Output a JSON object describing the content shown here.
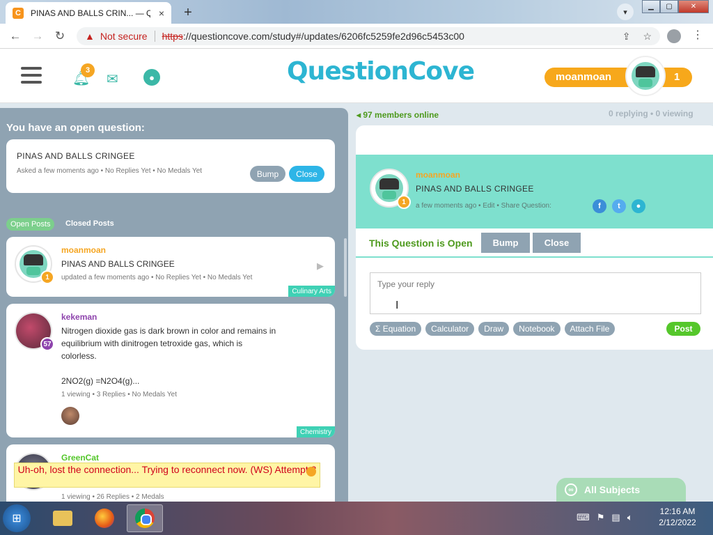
{
  "browser": {
    "tab_title": "PINAS AND BALLS CRIN... — Que",
    "tab_favicon": "C",
    "tab_close": "×",
    "new_tab": "+",
    "not_secure": "Not secure",
    "url_scheme": "https",
    "url_rest": "://questioncove.com/study#/updates/6206fc5259fe2d96c5453c00"
  },
  "header": {
    "logo": "QuestionCove",
    "notification_count": "3",
    "username": "moanmoan",
    "user_count": "1"
  },
  "open_question": {
    "heading": "You have an open question:",
    "title": "PINAS AND BALLS CRINGEE",
    "meta": "Asked a few moments ago  •  No Replies Yet  •  No Medals Yet",
    "bump_label": "Bump",
    "close_label": "Close"
  },
  "post_tabs": {
    "open": "Open Posts",
    "closed": "Closed Posts"
  },
  "posts": [
    {
      "user": "moanmoan",
      "user_color": "#f5a623",
      "level": "1",
      "level_color": "#f5a623",
      "title": "PINAS AND BALLS CRINGEE",
      "meta": "updated a few moments ago  •  No Replies Yet  •  No Medals Yet",
      "subject": "Culinary Arts",
      "subject_color": "#3fd1b5"
    },
    {
      "user": "kekeman",
      "user_color": "#8e44ad",
      "level": "57",
      "level_color": "#8e44ad",
      "title_lines": [
        "Nitrogen dioxide gas is dark brown in color and remains in",
        "equilibrium with dinitrogen tetroxide gas, which is",
        "colorless.",
        "",
        "2NO2(g) =N2O4(g)..."
      ],
      "meta": "1 viewing  •  3 Replies  •  No Medals Yet",
      "subject": "Chemistry",
      "subject_color": "#3fd1b5"
    },
    {
      "user": "GreenCat",
      "user_color": "#55c72b",
      "meta": "1 viewing  •  26 Replies  •  2 Medals"
    }
  ],
  "connection_warning": "Uh-oh, lost the connection... Trying to reconnect now. (WS) Attempt 3",
  "status": {
    "members_online": "97 members online",
    "replying": "0 replying  •  0 viewing"
  },
  "question": {
    "user": "moanmoan",
    "level": "1",
    "title": "PINAS AND BALLS CRINGEE",
    "meta": "a few moments ago  •  Edit  •  Share Question:",
    "status_text": "This Question is Open",
    "bump_label": "Bump",
    "close_label": "Close",
    "reply_placeholder": "Type your reply",
    "tools": [
      "Σ  Equation",
      "Calculator",
      "Draw",
      "Notebook",
      "Attach File"
    ],
    "post_label": "Post"
  },
  "all_subjects": "All Subjects",
  "taskbar": {
    "time": "12:16 AM",
    "date": "2/12/2022"
  }
}
